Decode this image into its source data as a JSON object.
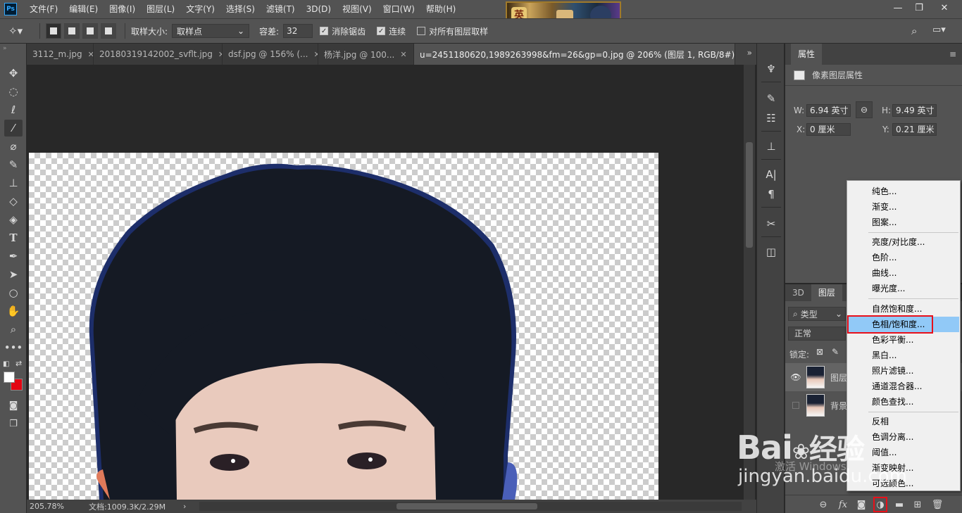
{
  "app": {
    "logo": "Ps",
    "menu": [
      "文件(F)",
      "编辑(E)",
      "图像(I)",
      "图层(L)",
      "文字(Y)",
      "选择(S)",
      "滤镜(T)",
      "3D(D)",
      "视图(V)",
      "窗口(W)",
      "帮助(H)"
    ],
    "window_controls": [
      "minimize-icon",
      "restore-icon",
      "close-icon"
    ],
    "banner_glyph": "英"
  },
  "options": {
    "sample_size_label": "取样大小:",
    "sample_size_value": "取样点",
    "tolerance_label": "容差:",
    "tolerance_value": "32",
    "antialias_label": "消除锯齿",
    "antialias_checked": true,
    "contiguous_label": "连续",
    "contiguous_checked": true,
    "all_layers_label": "对所有图层取样",
    "all_layers_checked": false
  },
  "tabs": [
    {
      "label": "3112_m.jpg",
      "active": false
    },
    {
      "label": "20180319142002_svflt.jpg",
      "active": false
    },
    {
      "label": "dsf.jpg @ 156% (...",
      "active": false
    },
    {
      "label": "杨洋.jpg @ 100...",
      "active": false
    },
    {
      "label": "u=2451180620,1989263998&fm=26&gp=0.jpg @ 206% (图层 1, RGB/8#) *",
      "active": true
    }
  ],
  "status": {
    "zoom": "205.78%",
    "doc_info": "文档:1009.3K/2.29M",
    "arrow": "›"
  },
  "properties": {
    "title": "属性",
    "subtitle": "像素图层属性",
    "w_label": "W:",
    "w_value": "6.94 英寸",
    "h_label": "H:",
    "h_value": "9.49 英寸",
    "x_label": "X:",
    "x_value": "0 厘米",
    "y_label": "Y:",
    "y_value": "0.21 厘米"
  },
  "layers": {
    "tab_3d": "3D",
    "tab_layers": "图层",
    "filter_label": "类型",
    "blend_mode": "正常",
    "lock_label": "锁定:",
    "items": [
      {
        "name": "图层",
        "visible": true
      },
      {
        "name": "背景",
        "visible": false
      }
    ]
  },
  "adjustment_menu": {
    "groups": [
      [
        "纯色...",
        "渐变...",
        "图案..."
      ],
      [
        "亮度/对比度...",
        "色阶...",
        "曲线...",
        "曝光度..."
      ],
      [
        "自然饱和度...",
        "色相/饱和度...",
        "色彩平衡...",
        "黑白...",
        "照片滤镜...",
        "通道混合器...",
        "颜色查找..."
      ],
      [
        "反相",
        "色调分离...",
        "阈值...",
        "渐变映射...",
        "可选颜色..."
      ]
    ],
    "highlighted": "色相/饱和度..."
  },
  "watermark": {
    "brand": "Bai",
    "brand_cn": "经验",
    "url": "jingyan.baidu.com",
    "activate_text": "激活 Windows"
  },
  "colors": {
    "highlight_border": "#e8101a",
    "menu_highlight": "#91c9f7",
    "foreground": "#ffffff",
    "background": "#e30613"
  }
}
